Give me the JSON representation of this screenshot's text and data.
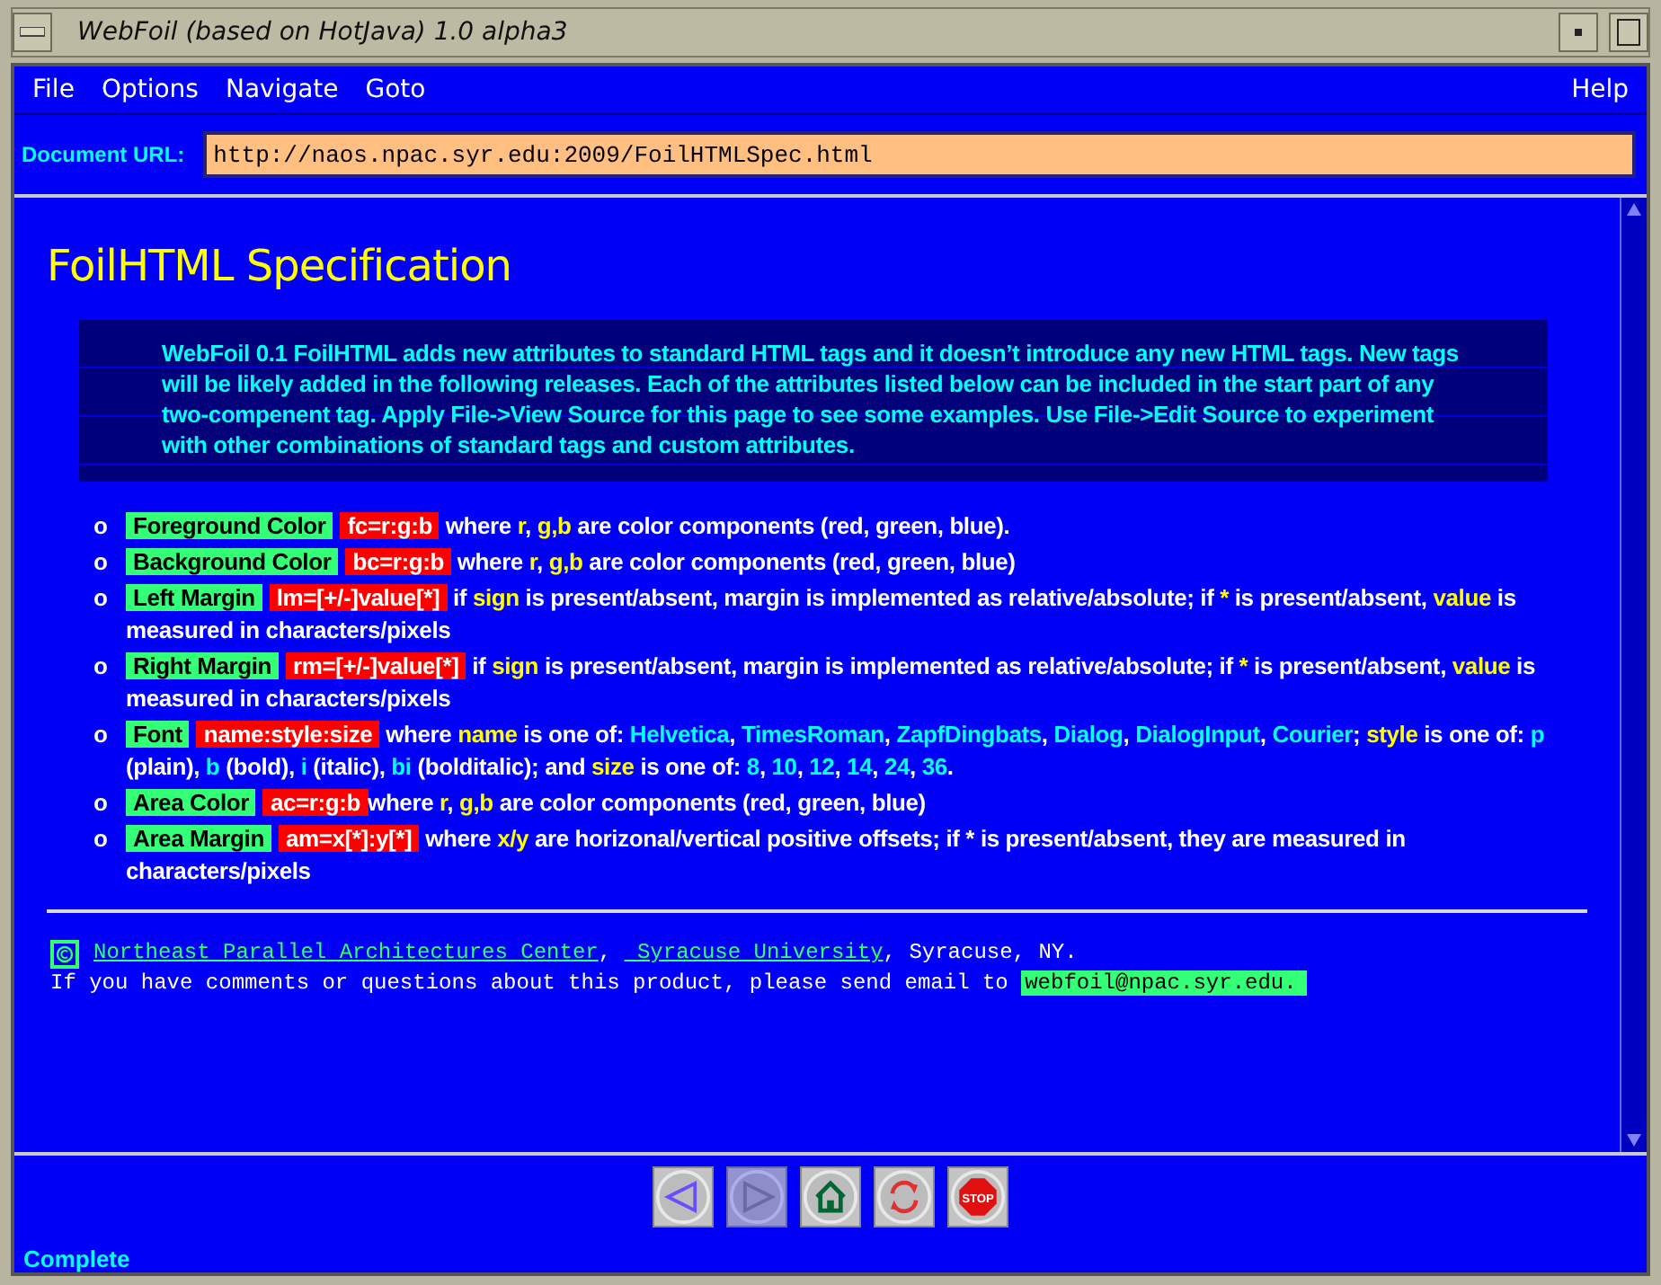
{
  "window": {
    "title": "WebFoil (based on HotJava) 1.0 alpha3"
  },
  "menu": {
    "items": [
      "File",
      "Options",
      "Navigate",
      "Goto"
    ],
    "help": "Help"
  },
  "url_bar": {
    "label": "Document URL:",
    "value": "http://naos.npac.syr.edu:2009/FoilHTMLSpec.html"
  },
  "page": {
    "heading": "FoilHTML Specification",
    "intro": "WebFoil 0.1 FoilHTML adds new attributes to standard HTML tags and it doesn’t introduce any new HTML tags. New tags will be likely added in the following releases. Each of the attributes listed below can be included in the start part of any two-compenent tag. Apply File->View Source for this page to see some examples. Use File->Edit Source to experiment with other combinations of standard tags and custom attributes.",
    "attributes": [
      {
        "bullet": "o",
        "name": "Foreground Color",
        "syntax": "fc=r:g:b",
        "description": [
          {
            "kind": "plain",
            "text": " where "
          },
          {
            "kind": "term",
            "text": "r"
          },
          {
            "kind": "plain",
            "text": ", "
          },
          {
            "kind": "term",
            "text": "g,b"
          },
          {
            "kind": "plain",
            "text": " are color components (red, green, blue)."
          }
        ]
      },
      {
        "bullet": "o",
        "name": "Background Color",
        "syntax": "bc=r:g:b",
        "description": [
          {
            "kind": "plain",
            "text": " where "
          },
          {
            "kind": "term",
            "text": "r"
          },
          {
            "kind": "plain",
            "text": ", "
          },
          {
            "kind": "term",
            "text": "g,b"
          },
          {
            "kind": "plain",
            "text": " are color components (red, green, blue)"
          }
        ]
      },
      {
        "bullet": "o",
        "name": "Left Margin",
        "syntax": "lm=[+/-]value[*]",
        "description": [
          {
            "kind": "plain",
            "text": " if "
          },
          {
            "kind": "term",
            "text": "sign"
          },
          {
            "kind": "plain",
            "text": " is present/absent, margin is implemented as relative/absolute; if "
          },
          {
            "kind": "term",
            "text": "*"
          },
          {
            "kind": "plain",
            "text": " is present/absent, "
          },
          {
            "kind": "term",
            "text": "value"
          },
          {
            "kind": "plain",
            "text": " is measured in characters/pixels"
          }
        ]
      },
      {
        "bullet": "o",
        "name": "Right Margin",
        "syntax": "rm=[+/-]value[*]",
        "description": [
          {
            "kind": "plain",
            "text": " if "
          },
          {
            "kind": "term",
            "text": "sign"
          },
          {
            "kind": "plain",
            "text": " is present/absent, margin is implemented as relative/absolute; if "
          },
          {
            "kind": "term",
            "text": "*"
          },
          {
            "kind": "plain",
            "text": " is present/absent, "
          },
          {
            "kind": "term",
            "text": "value"
          },
          {
            "kind": "plain",
            "text": " is measured in characters/pixels"
          }
        ]
      },
      {
        "bullet": "o",
        "name": "Font",
        "syntax": "name:style:size",
        "description": [
          {
            "kind": "plain",
            "text": " where "
          },
          {
            "kind": "term",
            "text": "name"
          },
          {
            "kind": "plain",
            "text": " is one of: "
          },
          {
            "kind": "value",
            "text": "Helvetica"
          },
          {
            "kind": "plain",
            "text": ", "
          },
          {
            "kind": "value",
            "text": "TimesRoman"
          },
          {
            "kind": "plain",
            "text": ", "
          },
          {
            "kind": "value",
            "text": "ZapfDingbats"
          },
          {
            "kind": "plain",
            "text": ", "
          },
          {
            "kind": "value",
            "text": "Dialog"
          },
          {
            "kind": "plain",
            "text": ", "
          },
          {
            "kind": "value",
            "text": "DialogInput"
          },
          {
            "kind": "plain",
            "text": ", "
          },
          {
            "kind": "value",
            "text": "Courier"
          },
          {
            "kind": "plain",
            "text": "; "
          },
          {
            "kind": "term",
            "text": "style"
          },
          {
            "kind": "plain",
            "text": " is one of: "
          },
          {
            "kind": "value",
            "text": "p"
          },
          {
            "kind": "plain",
            "text": " (plain), "
          },
          {
            "kind": "value",
            "text": "b"
          },
          {
            "kind": "plain",
            "text": " (bold), "
          },
          {
            "kind": "value",
            "text": "i"
          },
          {
            "kind": "plain",
            "text": " (italic), "
          },
          {
            "kind": "value",
            "text": "bi"
          },
          {
            "kind": "plain",
            "text": " (bolditalic); and "
          },
          {
            "kind": "term",
            "text": "size"
          },
          {
            "kind": "plain",
            "text": " is one of: "
          },
          {
            "kind": "value",
            "text": "8"
          },
          {
            "kind": "plain",
            "text": ", "
          },
          {
            "kind": "value",
            "text": "10"
          },
          {
            "kind": "plain",
            "text": ", "
          },
          {
            "kind": "value",
            "text": "12"
          },
          {
            "kind": "plain",
            "text": ", "
          },
          {
            "kind": "value",
            "text": "14"
          },
          {
            "kind": "plain",
            "text": ", "
          },
          {
            "kind": "value",
            "text": "24"
          },
          {
            "kind": "plain",
            "text": ", "
          },
          {
            "kind": "value",
            "text": "36"
          },
          {
            "kind": "plain",
            "text": "."
          }
        ]
      },
      {
        "bullet": "o",
        "name": "Area Color",
        "syntax": "ac=r:g:b",
        "description": [
          {
            "kind": "plain",
            "text": "where "
          },
          {
            "kind": "term",
            "text": "r"
          },
          {
            "kind": "plain",
            "text": ", "
          },
          {
            "kind": "term",
            "text": "g,b"
          },
          {
            "kind": "plain",
            "text": " are color components (red, green, blue)"
          }
        ]
      },
      {
        "bullet": "o",
        "name": "Area Margin",
        "syntax": "am=x[*]:y[*]",
        "description": [
          {
            "kind": "plain",
            "text": " where "
          },
          {
            "kind": "term",
            "text": "x/y"
          },
          {
            "kind": "plain",
            "text": " are horizonal/vertical positive offsets; if * is present/absent, they are measured in characters/pixels"
          }
        ]
      }
    ],
    "footer": {
      "credit": [
        {
          "kind": "link",
          "text": "Northeast Parallel Architectures Center"
        },
        {
          "kind": "plain",
          "text": ", "
        },
        {
          "kind": "link",
          "text": " Syracuse University"
        },
        {
          "kind": "plain",
          "text": ", Syracuse, NY."
        }
      ],
      "contact": "If you have comments or questions about this product, please send email to ",
      "email": "webfoil@npac.syr.edu."
    }
  },
  "toolbar": [
    {
      "kind": "back",
      "disabled": false
    },
    {
      "kind": "forward",
      "disabled": true
    },
    {
      "kind": "home",
      "disabled": false
    },
    {
      "kind": "reload",
      "disabled": false
    },
    {
      "kind": "stop",
      "disabled": false,
      "label": "STOP"
    }
  ],
  "status_bar": "Complete"
}
